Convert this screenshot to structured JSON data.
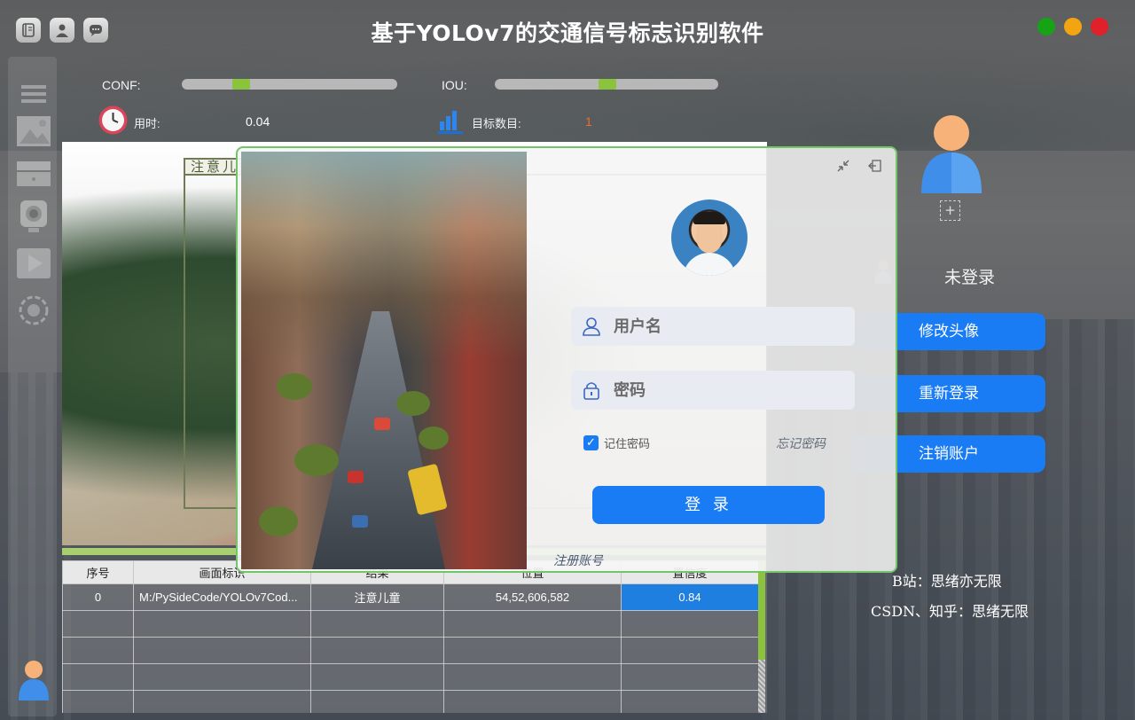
{
  "app": {
    "title": "基于YOLOv7的交通信号标志识别软件"
  },
  "colors": {
    "accent": "#1a7cf5",
    "slider_thumb": "#8bc43c",
    "close": "#e0202a",
    "minimize": "#f3a411",
    "maximize": "#16a316"
  },
  "title_icons": [
    "notebook-icon",
    "user-icon",
    "chat-icon"
  ],
  "controls": {
    "conf_label": "CONF:",
    "iou_label": "IOU:",
    "conf_value": 0.35,
    "iou_value": 0.5,
    "time_label": "用时:",
    "time_value": "0.04",
    "count_label": "目标数目:",
    "count_value": "1"
  },
  "detection": {
    "label": "注意儿童"
  },
  "sidebar": {
    "items": [
      "menu-icon",
      "image-icon",
      "folder-icon",
      "camera-icon",
      "video-icon",
      "settings-icon"
    ]
  },
  "table": {
    "columns": [
      "序号",
      "画面标识",
      "结果",
      "位置",
      "置信度"
    ],
    "rows": [
      [
        "0",
        "M:/PySideCode/YOLOv7Cod...",
        "注意儿童",
        "54,52,606,582",
        "0.84"
      ],
      [
        "",
        "",
        "",
        "",
        ""
      ],
      [
        "",
        "",
        "",
        "",
        ""
      ],
      [
        "",
        "",
        "",
        "",
        ""
      ],
      [
        "",
        "",
        "",
        "",
        ""
      ]
    ]
  },
  "right_panel": {
    "status": "未登录",
    "buttons": [
      "修改头像",
      "重新登录",
      "注销账户"
    ],
    "credit1": "B站：思绪亦无限",
    "credit2": "CSDN、知乎：思绪无限",
    "plus": "+"
  },
  "login": {
    "username_placeholder": "用户名",
    "password_placeholder": "密码",
    "remember_label": "记住密码",
    "remember_checked": true,
    "forgot_label": "忘记密码",
    "login_button": "登 录",
    "register_label": "注册账号"
  }
}
